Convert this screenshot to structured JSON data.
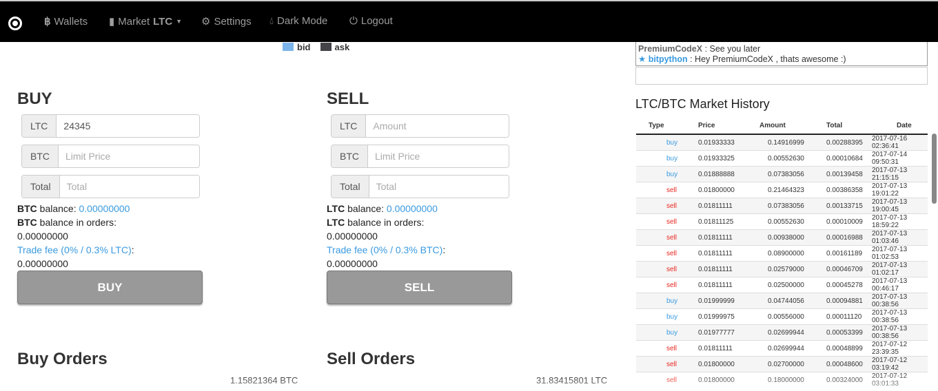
{
  "nav": {
    "wallets": "Wallets",
    "market": "Market",
    "market_coin": "LTC",
    "settings": "Settings",
    "dark_mode": "Dark Mode",
    "logout": "Logout"
  },
  "legend": {
    "bid": "bid",
    "ask": "ask",
    "bid_color": "#7cb5ec",
    "ask_color": "#434348"
  },
  "buy": {
    "title": "BUY",
    "ltc_label": "LTC",
    "ltc_value": "24345",
    "btc_label": "BTC",
    "btc_placeholder": "Limit Price",
    "total_label": "Total",
    "total_placeholder": "Total",
    "balance_coin": "BTC",
    "balance_text": " balance: ",
    "balance": "0.00000000",
    "orders_coin": "BTC",
    "orders_text": " balance in orders:",
    "orders_balance": "0.00000000",
    "fee_label": "Trade fee (0% / 0.3% LTC)",
    "fee_value": "0.00000000",
    "button": "BUY"
  },
  "sell": {
    "title": "SELL",
    "ltc_label": "LTC",
    "ltc_placeholder": "Amount",
    "btc_label": "BTC",
    "btc_placeholder": "Limit Price",
    "total_label": "Total",
    "total_placeholder": "Total",
    "balance_coin": "LTC",
    "balance_text": " balance: ",
    "balance": "0.00000000",
    "orders_coin": "LTC",
    "orders_text": " balance in orders:",
    "orders_balance": "0.00000000",
    "fee_label": "Trade fee (0% / 0.3% BTC)",
    "fee_value": "0.00000000",
    "button": "SELL"
  },
  "buy_orders": {
    "title": "Buy Orders",
    "total": "1.15821364 BTC"
  },
  "sell_orders": {
    "title": "Sell Orders",
    "total": "31.83415801 LTC"
  },
  "chat": {
    "messages": [
      {
        "user": "PremiumCodeX",
        "text": " : See you later"
      },
      {
        "user": "bitpython",
        "text": " : Hey PremiumCodeX , thats awesome :)"
      }
    ]
  },
  "history": {
    "title": "LTC/BTC Market History",
    "headers": [
      "Type",
      "Price",
      "Amount",
      "Total",
      "Date"
    ],
    "rows": [
      [
        "buy",
        "0.01933333",
        "0.14916999",
        "0.00288395",
        "2017-07-16 02:36:41"
      ],
      [
        "buy",
        "0.01933325",
        "0.00552630",
        "0.00010684",
        "2017-07-14 09:50:31"
      ],
      [
        "buy",
        "0.01888888",
        "0.07383056",
        "0.00139458",
        "2017-07-13 21:15:15"
      ],
      [
        "sell",
        "0.01800000",
        "0.21464323",
        "0.00386358",
        "2017-07-13 19:01:22"
      ],
      [
        "sell",
        "0.01811111",
        "0.07383056",
        "0.00133715",
        "2017-07-13 19:00:45"
      ],
      [
        "sell",
        "0.01811125",
        "0.00552630",
        "0.00010009",
        "2017-07-13 18:59:22"
      ],
      [
        "sell",
        "0.01811111",
        "0.00938000",
        "0.00016988",
        "2017-07-13 01:03:46"
      ],
      [
        "sell",
        "0.01811111",
        "0.08900000",
        "0.00161189",
        "2017-07-13 01:02:53"
      ],
      [
        "sell",
        "0.01811111",
        "0.02579000",
        "0.00046709",
        "2017-07-13 01:02:17"
      ],
      [
        "sell",
        "0.01811111",
        "0.02500000",
        "0.00045278",
        "2017-07-13 00:46:17"
      ],
      [
        "buy",
        "0.01999999",
        "0.04744056",
        "0.00094881",
        "2017-07-13 00:38:56"
      ],
      [
        "buy",
        "0.01999975",
        "0.00556000",
        "0.00011120",
        "2017-07-13 00:38:56"
      ],
      [
        "buy",
        "0.01977777",
        "0.02699944",
        "0.00053399",
        "2017-07-13 00:38:56"
      ],
      [
        "sell",
        "0.01811111",
        "0.02699944",
        "0.00048899",
        "2017-07-12 23:39:35"
      ],
      [
        "sell",
        "0.01800000",
        "0.02700000",
        "0.00048600",
        "2017-07-12 03:19:42"
      ],
      [
        "sell",
        "0.01800000",
        "0.18000000",
        "0.00324000",
        "2017-07-12 03:01:33"
      ]
    ]
  },
  "colors": {
    "buy": "#3a9ae0",
    "sell": "#e8261f",
    "nav_bg": "#000000"
  }
}
